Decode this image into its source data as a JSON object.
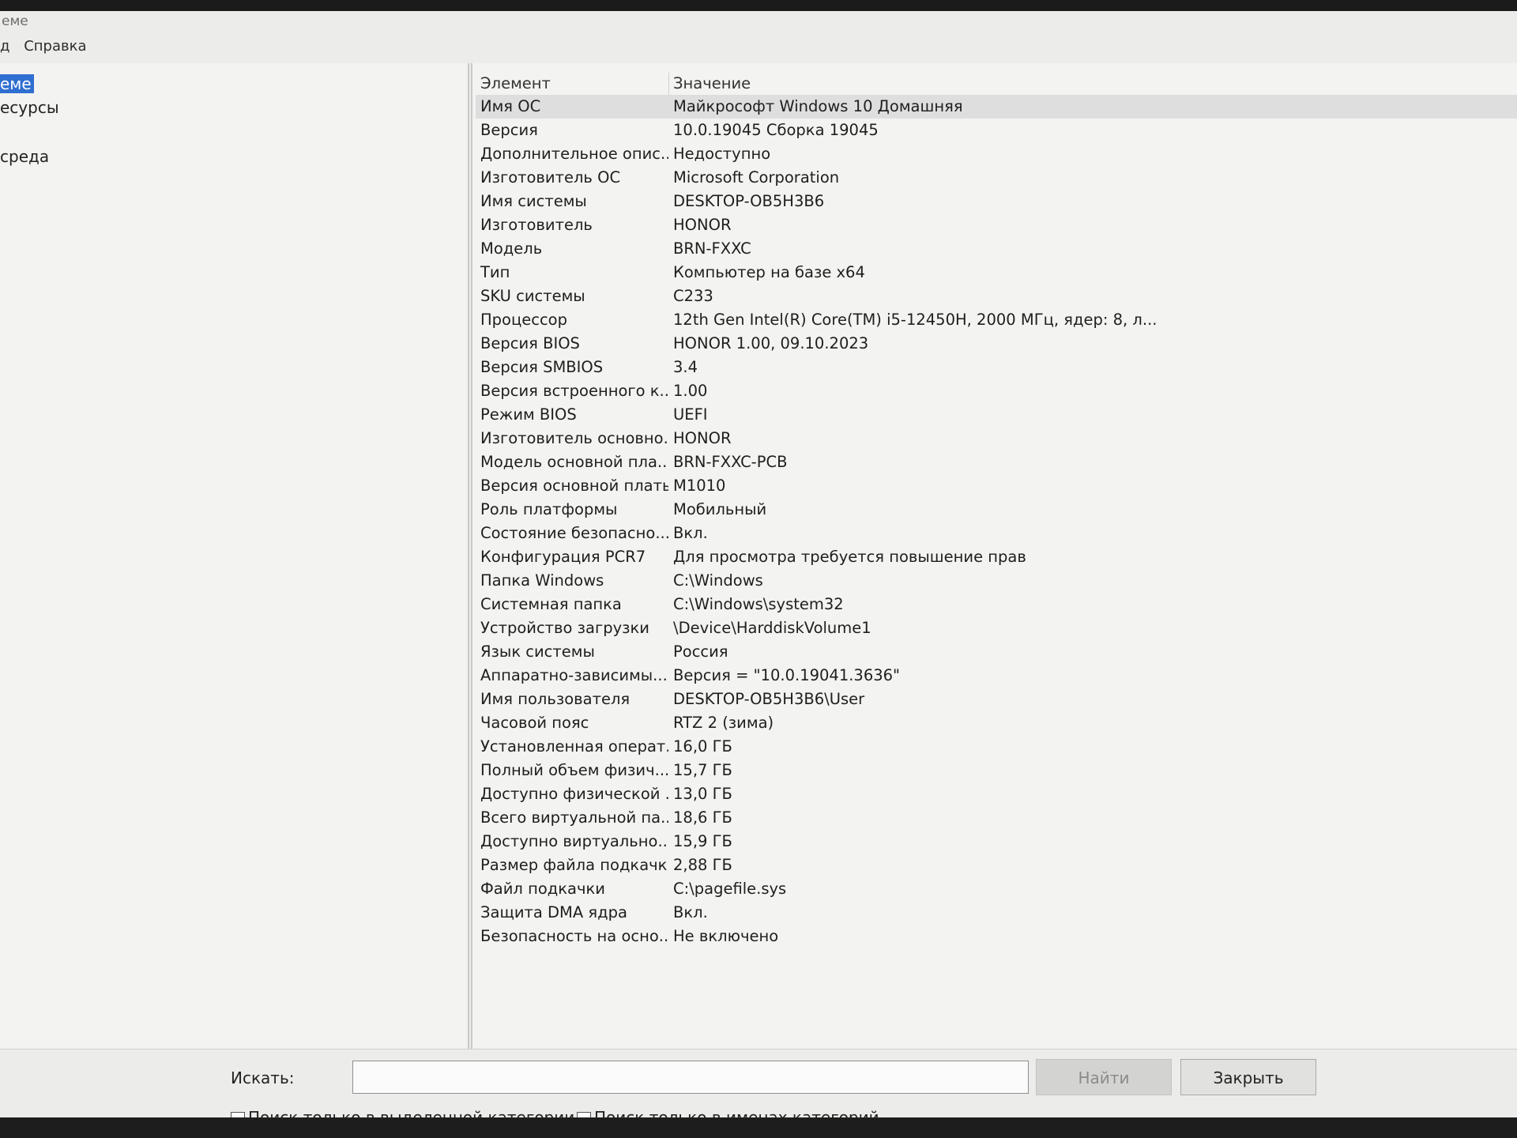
{
  "window": {
    "title_fragment": "еме"
  },
  "menu": {
    "items": [
      "д",
      "Справка"
    ]
  },
  "tree": {
    "items": [
      {
        "label": "еме",
        "selected": true
      },
      {
        "label": "есурсы",
        "selected": false
      },
      {
        "label": "среда",
        "selected": false
      }
    ]
  },
  "table": {
    "headers": {
      "element": "Элемент",
      "value": "Значение"
    },
    "rows": [
      {
        "element": "Имя ОС",
        "value": "Майкрософт Windows 10 Домашняя"
      },
      {
        "element": "Версия",
        "value": "10.0.19045 Сборка 19045"
      },
      {
        "element": "Дополнительное опис...",
        "value": "Недоступно"
      },
      {
        "element": "Изготовитель ОС",
        "value": "Microsoft Corporation"
      },
      {
        "element": "Имя системы",
        "value": "DESKTOP-OB5H3B6"
      },
      {
        "element": "Изготовитель",
        "value": "HONOR"
      },
      {
        "element": "Модель",
        "value": "BRN-FXXC"
      },
      {
        "element": "Тип",
        "value": "Компьютер на базе x64"
      },
      {
        "element": "SKU системы",
        "value": "C233"
      },
      {
        "element": "Процессор",
        "value": "12th Gen Intel(R) Core(TM) i5-12450H, 2000 МГц, ядер: 8, л..."
      },
      {
        "element": "Версия BIOS",
        "value": "HONOR 1.00, 09.10.2023"
      },
      {
        "element": "Версия SMBIOS",
        "value": "3.4"
      },
      {
        "element": "Версия встроенного к...",
        "value": "1.00"
      },
      {
        "element": "Режим BIOS",
        "value": "UEFI"
      },
      {
        "element": "Изготовитель основно...",
        "value": "HONOR"
      },
      {
        "element": "Модель основной пла...",
        "value": "BRN-FXXC-PCB"
      },
      {
        "element": "Версия основной платы",
        "value": "M1010"
      },
      {
        "element": "Роль платформы",
        "value": "Мобильный"
      },
      {
        "element": "Состояние безопасно...",
        "value": "Вкл."
      },
      {
        "element": "Конфигурация PCR7",
        "value": "Для просмотра требуется повышение прав"
      },
      {
        "element": "Папка Windows",
        "value": "C:\\Windows"
      },
      {
        "element": "Системная папка",
        "value": "C:\\Windows\\system32"
      },
      {
        "element": "Устройство загрузки",
        "value": "\\Device\\HarddiskVolume1"
      },
      {
        "element": "Язык системы",
        "value": "Россия"
      },
      {
        "element": "Аппаратно-зависимы...",
        "value": "Версия = \"10.0.19041.3636\""
      },
      {
        "element": "Имя пользователя",
        "value": "DESKTOP-OB5H3B6\\User"
      },
      {
        "element": "Часовой пояс",
        "value": "RTZ 2 (зима)"
      },
      {
        "element": "Установленная операт...",
        "value": "16,0 ГБ"
      },
      {
        "element": "Полный объем физич...",
        "value": "15,7 ГБ"
      },
      {
        "element": "Доступно физической ...",
        "value": "13,0 ГБ"
      },
      {
        "element": "Всего виртуальной па...",
        "value": "18,6 ГБ"
      },
      {
        "element": "Доступно виртуально...",
        "value": "15,9 ГБ"
      },
      {
        "element": "Размер файла подкачки",
        "value": "2,88 ГБ"
      },
      {
        "element": "Файл подкачки",
        "value": "C:\\pagefile.sys"
      },
      {
        "element": "Защита DMA ядра",
        "value": "Вкл."
      },
      {
        "element": "Безопасность на осно...",
        "value": "Не включено"
      }
    ]
  },
  "search": {
    "label": "Искать:",
    "value": "",
    "find_button": "Найти",
    "close_button": "Закрыть",
    "checkbox_selected_category": "Поиск только в выделенной категории",
    "checkbox_category_names": "Поиск только в именах категорий"
  },
  "colors": {
    "selection": "#2f6fd1",
    "row_highlight": "#dedede"
  }
}
